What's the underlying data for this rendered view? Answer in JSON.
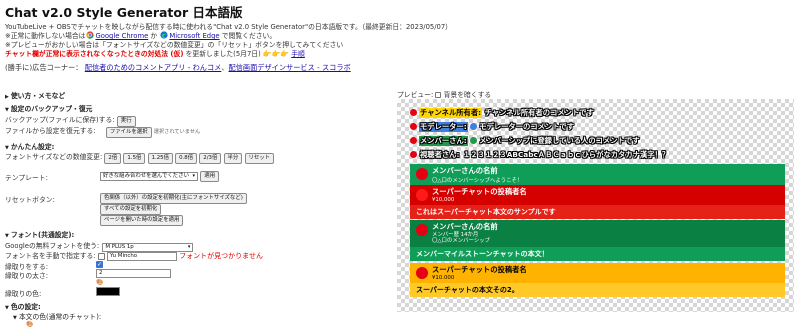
{
  "header": {
    "title": "Chat v2.0 Style Generator 日本語版",
    "desc": "YouTubeLive + OBSでチャットを映しながら配信する時に使われる\"Chat v2.0 Style Generator\"の日本語版です。（最終更新日：2023/05/07）",
    "browser_note_pre": "※正常に動作しない場合は",
    "chrome_link": "Google Chrome",
    "browser_note_or": " か ",
    "edge_link": "Microsoft Edge",
    "browser_note_post": " で閲覧ください。",
    "reset_note": "※プレビューがおかしい場合は「フォントサイズなどの数値変更」の「リセット」ボタンを押してみてください",
    "warning_red": "チャット欄が正常に表示されなくなったときの対処法 (仮)",
    "warning_post": " を更新しました(5月7日)",
    "warning_emoji": "👉👉👉",
    "howto_link": "手順",
    "ad_prefix": "(勝手に)広告コーナー：",
    "ad_link1": "配信者のためのコメントアプリ - わんコメ",
    "ad_sep": "、",
    "ad_link2": "配信画面デザインサービス - スコラボ"
  },
  "sections": {
    "howto": "使い方・メモなど",
    "backup": "設定のバックアップ・復元",
    "easy": "かんたん設定:",
    "font": "フォント(共通設定):",
    "color": "色の設定:",
    "text_color": "本文の色(通常のチャット):"
  },
  "backup": {
    "save_label": "バックアップ(ファイルに保存)する:",
    "save_btn": "実行",
    "restore_label": "ファイルから設定を復元する:",
    "file_btn": "ファイルを選択",
    "file_status": "選択されていません"
  },
  "easy": {
    "size_label": "フォントサイズなどの数値変更:",
    "size_buttons": [
      "2倍",
      "1.5倍",
      "1.25倍",
      "0.8倍",
      "2/3倍",
      "半分",
      "リセット"
    ],
    "template_label": "テンプレート:",
    "template_value": "好きな組み合わせを選んでください",
    "apply_btn": "適用",
    "reset_label": "リセットボタン:",
    "reset_buttons": [
      "色関係（以外）の設定を初期化(主にフォントサイズなど)",
      "すべての設定を初期化",
      "ページを開いた時の設定を適用"
    ]
  },
  "font": {
    "google_label": "Googleの無料フォントを使う:",
    "google_value": "M PLUS 1p",
    "manual_label": "フォント名を手動で指定する:",
    "manual_value": "Yu Mincho",
    "not_found": "フォントが見つかりません",
    "outline_label": "縁取りをする:",
    "outline_width_label": "縁取りの太さ:",
    "outline_width_value": "2",
    "outline_color_label": "縁取りの色:"
  },
  "preview": {
    "label": "プレビュー:",
    "hide_bg_label": "背景を暗くする",
    "lines": [
      {
        "name": "チャンネル所有者:",
        "text": "チャンネル所有者のコメントです",
        "dot": "#e60012",
        "bg": "#ffd600",
        "color": "#000000"
      },
      {
        "name": "モデレーター:",
        "text": "モデレーターのコメントです",
        "dot": "#e60012",
        "bg": "#3f7fe0",
        "color": "#ffffff"
      },
      {
        "name": "メンバーさん:",
        "text": "メンバーシップに登録している人のコメントです",
        "dot": "#e60012",
        "bg": "#1f9a4a",
        "color": "#ffffff"
      },
      {
        "name": "視聴者さん:",
        "text": "１２３１２３ABCabcＡＢＣａｂｃひらがなカタカナ漢字！？",
        "dot": "#e60012",
        "bg": "transparent",
        "color": "#ffffff"
      }
    ],
    "cards": [
      {
        "kind": "member",
        "name": "メンバーさんの名前",
        "sub": "〇△口のメンバーシップへようこそ！",
        "body": "",
        "head_bg": "#0f9d58",
        "body_bg": "#0f9d58"
      },
      {
        "kind": "superchat",
        "name": "スーパーチャットの投稿者名",
        "sub": "¥10,000",
        "body": "これはスーパーチャット本文のサンプルです",
        "head_bg": "#d50000",
        "body_bg": "#e62117"
      },
      {
        "kind": "milestone",
        "name": "メンバーさんの名前",
        "sub": "メンバー歴 14か月\n〇△口のメンバーシップ",
        "body": "メンバーマイルストーンチャットの本文！",
        "head_bg": "#0a8043",
        "body_bg": "#0f9d58"
      },
      {
        "kind": "superchat2",
        "name": "スーパーチャットの投稿者名",
        "sub": "¥10.000",
        "body": "スーパーチャットの本文その2。",
        "head_bg": "#ffb300",
        "body_bg": "#ffca28"
      }
    ]
  },
  "colors": {
    "link": "#1a0dab",
    "warning": "#e00000"
  }
}
